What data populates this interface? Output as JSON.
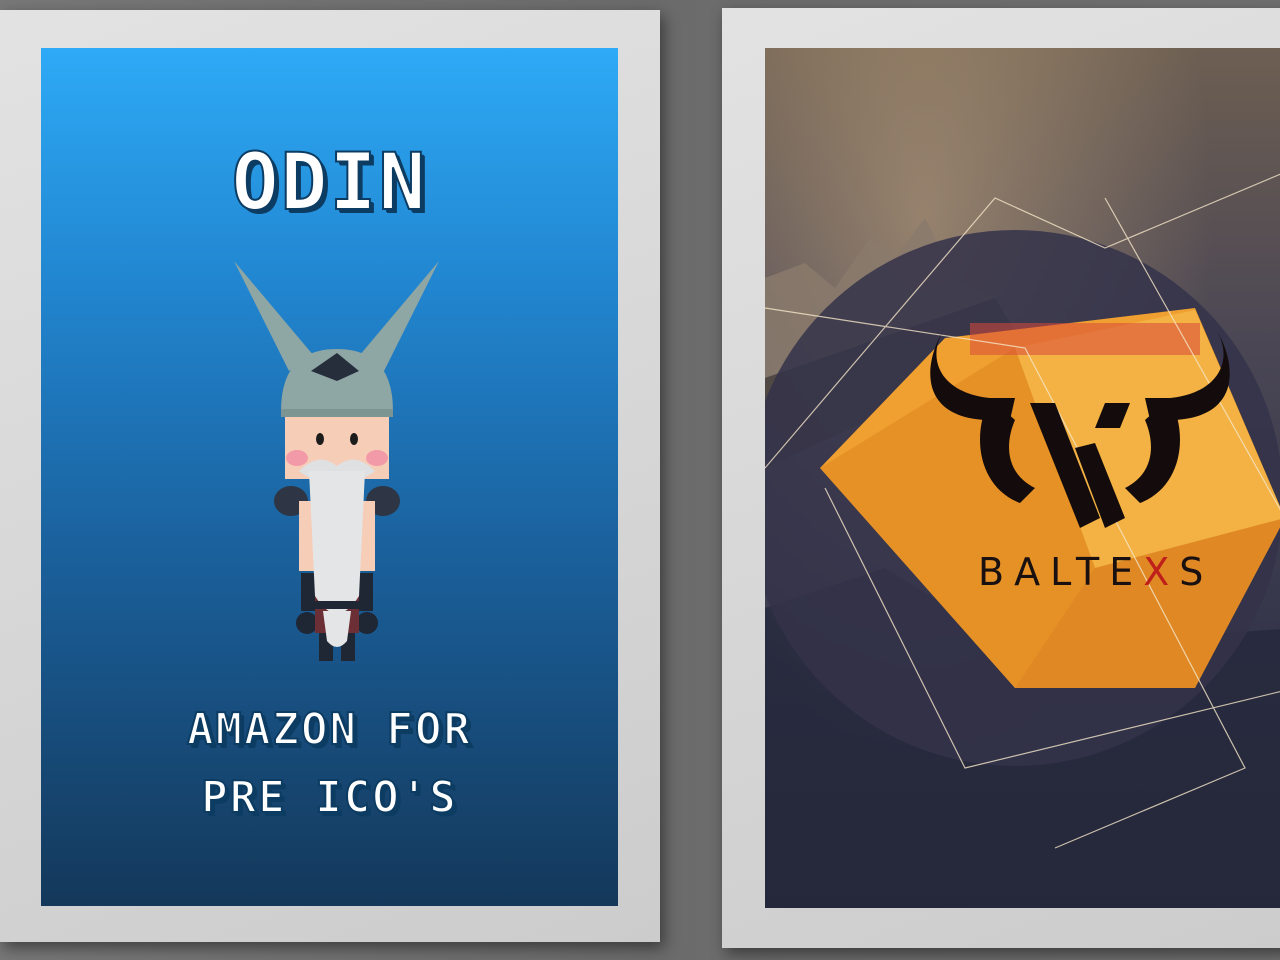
{
  "left_poster": {
    "title": "ODIN",
    "tagline_line1": "AMAZON FOR",
    "tagline_line2": "PRE ICO'S",
    "background_colors": [
      "#2eaaf6",
      "#14385a"
    ],
    "illustration": "viking-character"
  },
  "right_poster": {
    "brand_part1": "BALTE",
    "brand_x": "X",
    "brand_part2": "S",
    "logo": "bull-horns-logo",
    "accent_color": "#f0a030",
    "x_color": "#c0201a"
  }
}
